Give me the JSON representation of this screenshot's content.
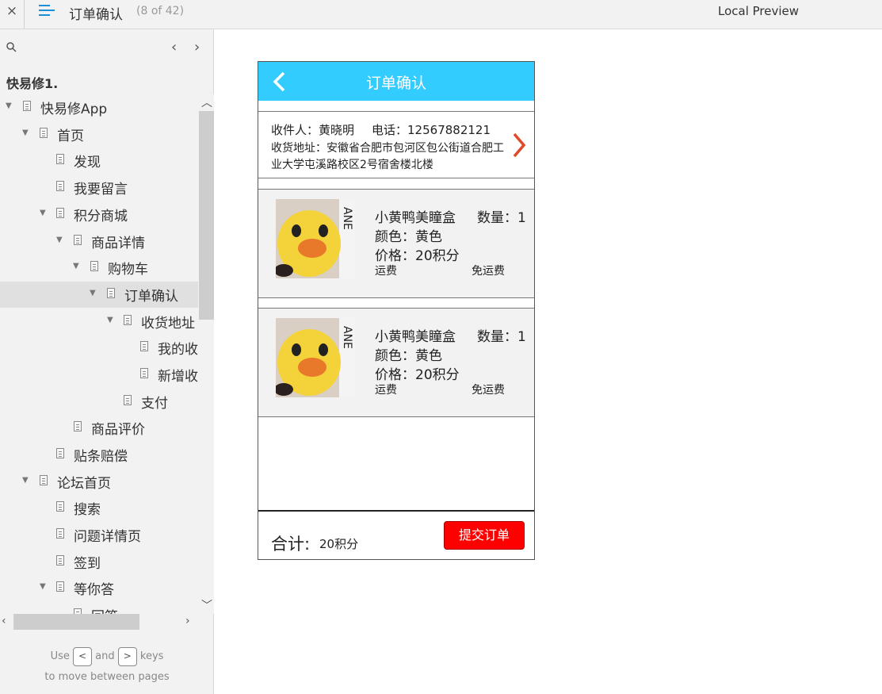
{
  "topbar": {
    "close_glyph": "×",
    "title": "订单确认",
    "page_count": "(8 of 42)",
    "preview_label": "Local Preview"
  },
  "sidebar": {
    "project_name": "快易修1.",
    "nav_prev": "‹",
    "nav_next": "›",
    "items": [
      {
        "label": "快易修App",
        "expanded": true
      },
      {
        "label": "首页",
        "expanded": true
      },
      {
        "label": "发现"
      },
      {
        "label": "我要留言"
      },
      {
        "label": "积分商城",
        "expanded": true
      },
      {
        "label": "商品详情",
        "expanded": true
      },
      {
        "label": "购物车",
        "expanded": true
      },
      {
        "label": "订单确认",
        "expanded": true,
        "selected": true
      },
      {
        "label": "收货地址",
        "expanded": true
      },
      {
        "label": "我的收"
      },
      {
        "label": "新增收"
      },
      {
        "label": "支付"
      },
      {
        "label": "商品评价"
      },
      {
        "label": "贴条赔偿"
      },
      {
        "label": "论坛首页",
        "expanded": true
      },
      {
        "label": "搜索"
      },
      {
        "label": "问题详情页"
      },
      {
        "label": "签到"
      },
      {
        "label": "等你答",
        "expanded": true
      },
      {
        "label": "回答"
      }
    ],
    "hint": {
      "use": "Use",
      "key_prev": "<",
      "and": "and",
      "key_next": ">",
      "keys": "keys",
      "line2": "to move between pages"
    }
  },
  "phone": {
    "title": "订单确认",
    "address": {
      "receiver": "收件人：黄晓明",
      "phone": "电话：12567882121",
      "address": "收货地址：安徽省合肥市包河区包公街道合肥工业大学屯溪路校区2号宿舍楼北楼"
    },
    "items": [
      {
        "name": "小黄鸭美瞳盒",
        "qty": "数量：1",
        "color": "颜色：黄色",
        "price": "价格：20积分",
        "ship_label": "运费",
        "ship_value": "免运费"
      },
      {
        "name": "小黄鸭美瞳盒",
        "qty": "数量：1",
        "color": "颜色：黄色",
        "price": "价格：20积分",
        "ship_label": "运费",
        "ship_value": "免运费"
      }
    ],
    "total_label": "合计:",
    "total_value": "20积分",
    "submit_label": "提交订单"
  },
  "colors": {
    "header": "#33ccff",
    "submit": "#ff0000",
    "arrow": "#e04a2a",
    "accent": "#1d8fd6"
  },
  "icons": [
    "close-icon",
    "menu-icon",
    "search-icon",
    "back-icon",
    "chevron-right-icon",
    "page-icon"
  ]
}
